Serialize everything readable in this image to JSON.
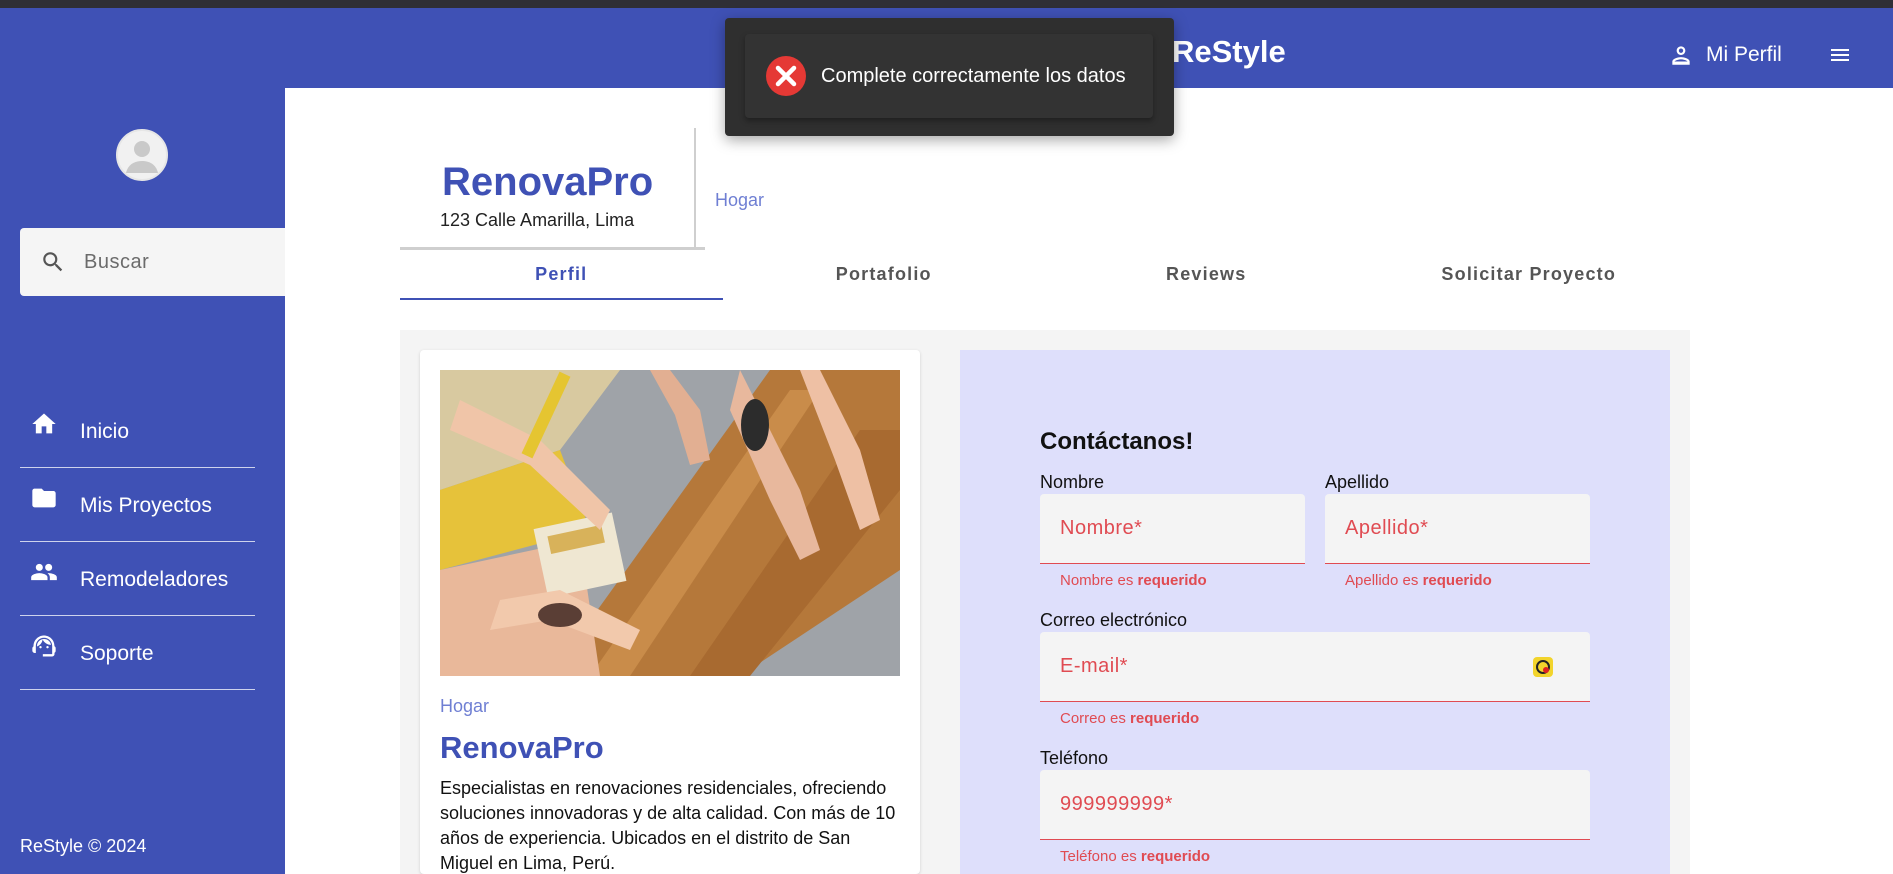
{
  "app": {
    "brand": "ReStyle",
    "profile_label": "Mi Perfil",
    "footer": "ReStyle © 2024"
  },
  "search": {
    "placeholder": "Buscar"
  },
  "sidebar": {
    "items": [
      {
        "label": "Inicio",
        "icon": "home-icon"
      },
      {
        "label": "Mis Proyectos",
        "icon": "folder-icon"
      },
      {
        "label": "Remodeladores",
        "icon": "people-icon"
      },
      {
        "label": "Soporte",
        "icon": "support-agent-icon"
      }
    ]
  },
  "company": {
    "name": "RenovaPro",
    "address": "123 Calle Amarilla, Lima",
    "category": "Hogar"
  },
  "tabs": [
    {
      "label": "Perfil",
      "active": true
    },
    {
      "label": "Portafolio",
      "active": false
    },
    {
      "label": "Reviews",
      "active": false
    },
    {
      "label": "Solicitar Proyecto",
      "active": false
    }
  ],
  "card": {
    "category": "Hogar",
    "title": "RenovaPro",
    "description": "Especialistas en renovaciones residenciales, ofreciendo soluciones innovadoras y de alta calidad. Con más de 10 años de experiencia. Ubicados en el distrito de San Miguel en Lima, Perú."
  },
  "form": {
    "title": "Contáctanos!",
    "nombre": {
      "label": "Nombre",
      "placeholder": "Nombre*",
      "error_prefix": "Nombre es ",
      "error_strong": "requerido"
    },
    "apellido": {
      "label": "Apellido",
      "placeholder": "Apellido*",
      "error_prefix": "Apellido es ",
      "error_strong": "requerido"
    },
    "correo": {
      "label": "Correo electrónico",
      "placeholder": "E-mail*",
      "error_prefix": "Correo es ",
      "error_strong": "requerido"
    },
    "telefono": {
      "label": "Teléfono",
      "placeholder": "999999999*",
      "error_prefix": "Teléfono es ",
      "error_strong": "requerido"
    }
  },
  "toast": {
    "message": "Complete correctamente los datos",
    "icon": "error-x-icon"
  },
  "colors": {
    "primary": "#3f51b5",
    "error": "#e04b52",
    "form_bg": "#dedffb",
    "toast_bg": "#2f2f2f"
  }
}
